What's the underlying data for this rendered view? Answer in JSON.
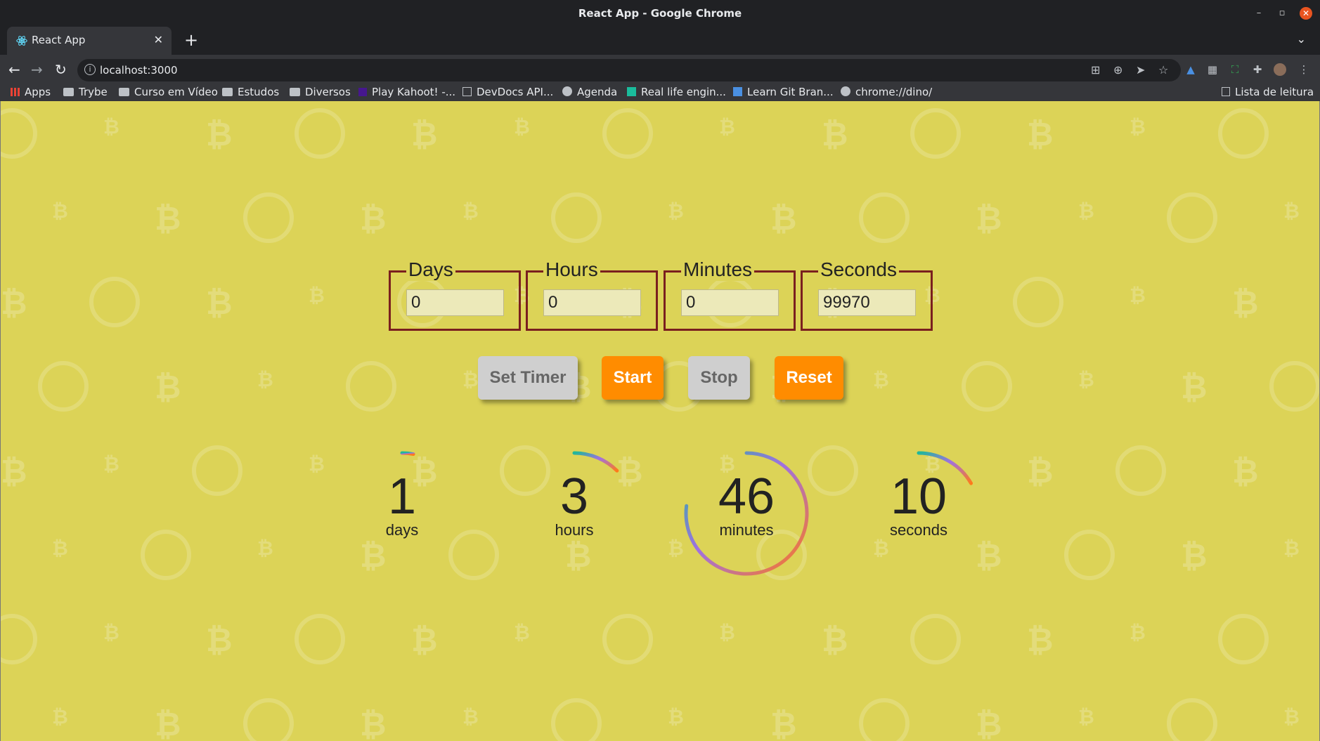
{
  "window": {
    "title": "React App - Google Chrome"
  },
  "tab": {
    "title": "React App",
    "icon": "react-icon"
  },
  "address_bar": {
    "url": "localhost:3000"
  },
  "bookmarks": [
    {
      "label": "Apps",
      "icon": "apps-grid-icon"
    },
    {
      "label": "Trybe",
      "icon": "folder-icon"
    },
    {
      "label": "Curso em Vídeo",
      "icon": "folder-icon"
    },
    {
      "label": "Estudos",
      "icon": "folder-icon"
    },
    {
      "label": "Diversos",
      "icon": "folder-icon"
    },
    {
      "label": "Play Kahoot! -...",
      "icon": "kahoot-icon"
    },
    {
      "label": "DevDocs API...",
      "icon": "devdocs-icon"
    },
    {
      "label": "Agenda",
      "icon": "globe-icon"
    },
    {
      "label": "Real life engin...",
      "icon": "site-icon"
    },
    {
      "label": "Learn Git Bran...",
      "icon": "git-icon"
    },
    {
      "label": "chrome://dino/",
      "icon": "globe-icon"
    }
  ],
  "reading_list": "Lista de leitura",
  "form": {
    "fields": [
      {
        "label": "Days",
        "value": "0"
      },
      {
        "label": "Hours",
        "value": "0"
      },
      {
        "label": "Minutes",
        "value": "0"
      },
      {
        "label": "Seconds",
        "value": "99970"
      }
    ]
  },
  "buttons": {
    "set_timer": "Set Timer",
    "start": "Start",
    "stop": "Stop",
    "reset": "Reset"
  },
  "countdown": [
    {
      "value": "1",
      "unit": "days",
      "progress": 0.03
    },
    {
      "value": "3",
      "unit": "hours",
      "progress": 0.125
    },
    {
      "value": "46",
      "unit": "minutes",
      "progress": 0.77
    },
    {
      "value": "10",
      "unit": "seconds",
      "progress": 0.167
    }
  ],
  "colors": {
    "page_background": "#dcd357",
    "fieldset_border": "#7a1f1f",
    "button_orange": "#ff8c00",
    "button_grey": "#cfcfcf"
  }
}
